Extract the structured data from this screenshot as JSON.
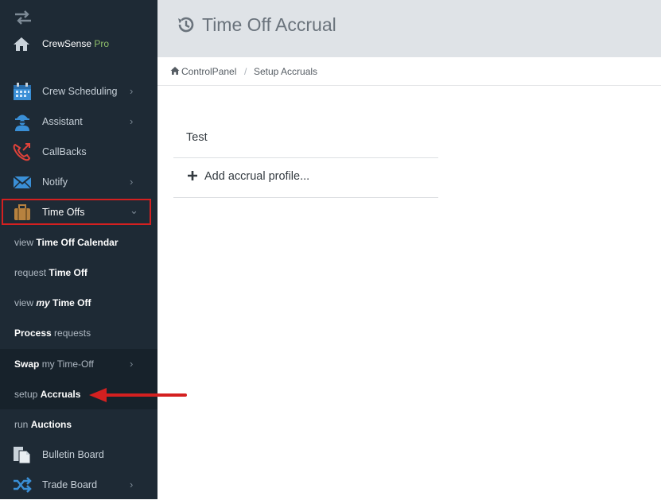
{
  "brand": {
    "name": "CrewSense",
    "suffix": "Pro"
  },
  "sidebar": {
    "items": [
      {
        "label": "Crew Scheduling",
        "icon": "calendar-icon",
        "chevron": "›"
      },
      {
        "label": "Assistant",
        "icon": "assistant-icon",
        "chevron": "›"
      },
      {
        "label": "CallBacks",
        "icon": "callback-phone-icon"
      },
      {
        "label": "Notify",
        "icon": "envelope-icon",
        "chevron": "›"
      },
      {
        "label": "Time Offs",
        "icon": "briefcase-icon",
        "chevron": "⌄"
      }
    ],
    "sub_items": [
      {
        "prefix": "view",
        "bold": "Time Off Calendar"
      },
      {
        "prefix": "request",
        "bold": "Time Off"
      },
      {
        "prefix": "view",
        "bold_italic": "my",
        "bold": "Time Off"
      },
      {
        "bold_first": "Process",
        "suffix": "requests"
      },
      {
        "bold_first": "Swap",
        "suffix": "my Time-Off",
        "chevron": "›"
      },
      {
        "prefix": "setup",
        "bold": "Accruals"
      },
      {
        "prefix": "run",
        "bold": "Auctions"
      }
    ],
    "bottom_items": [
      {
        "label": "Bulletin Board",
        "icon": "bulletin-icon"
      },
      {
        "label": "Trade Board",
        "icon": "shuffle-icon",
        "chevron": "›"
      }
    ]
  },
  "header": {
    "title": "Time Off Accrual"
  },
  "breadcrumb": {
    "home": "ControlPanel",
    "separator": "/",
    "current": "Setup Accruals"
  },
  "profiles": {
    "items": [
      "Test"
    ],
    "add_label": "Add accrual profile..."
  },
  "colors": {
    "sidebar_bg": "#1e2a35",
    "highlight": "#d42020",
    "header_bg": "#dfe3e7"
  }
}
